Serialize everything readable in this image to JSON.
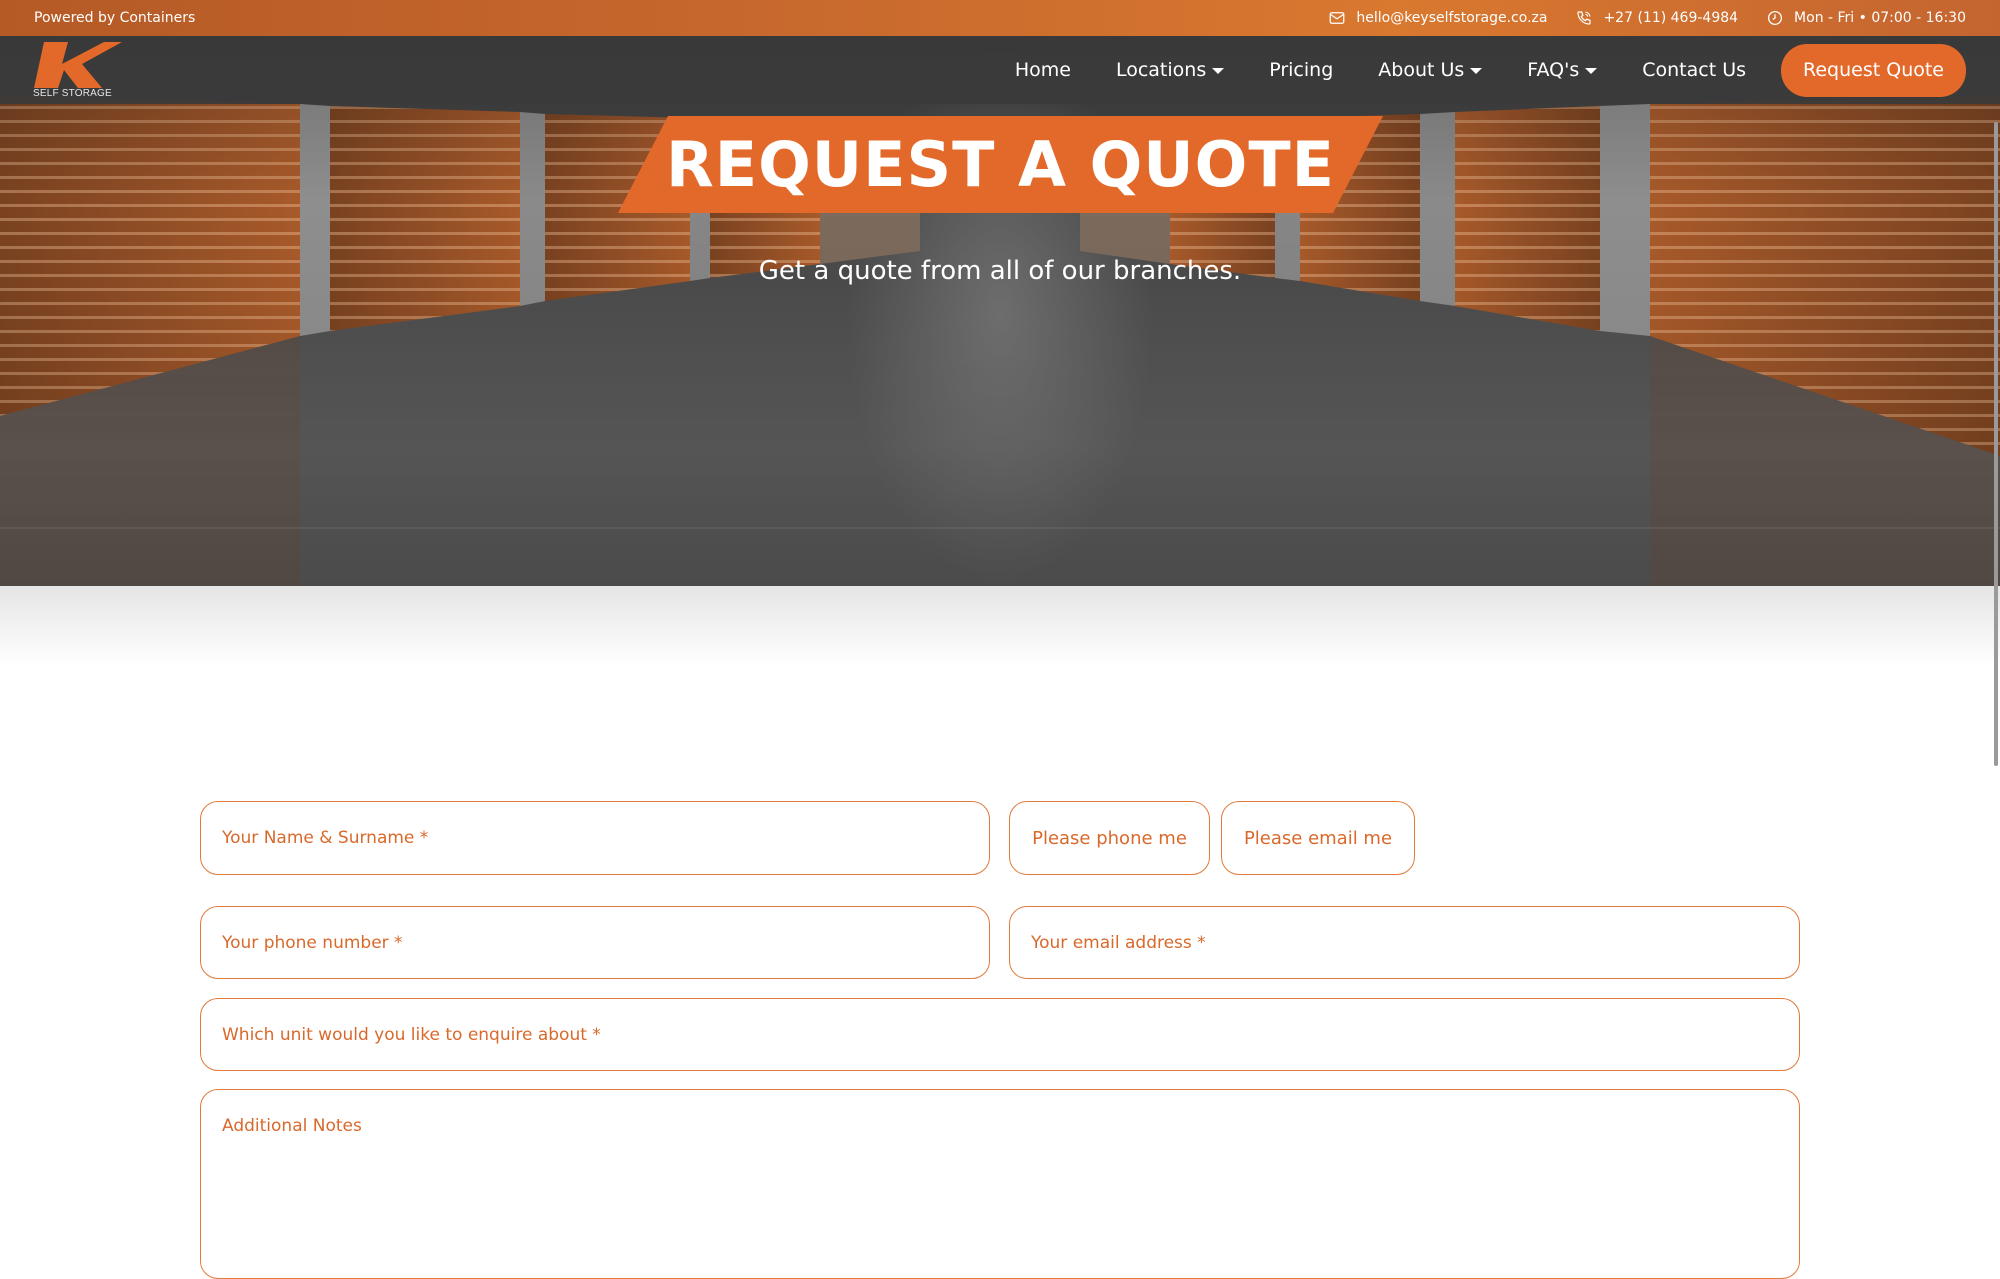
{
  "topbar": {
    "powered": "Powered by Containers",
    "email": "hello@keyselfstorage.co.za",
    "phone": "+27 (11) 469-4984",
    "hours": "Mon - Fri • 07:00 - 16:30"
  },
  "logo": {
    "letter": "K",
    "text": "SELF STORAGE"
  },
  "nav": {
    "items": [
      {
        "label": "Home",
        "dropdown": false
      },
      {
        "label": "Locations",
        "dropdown": true
      },
      {
        "label": "Pricing",
        "dropdown": false
      },
      {
        "label": "About Us",
        "dropdown": true
      },
      {
        "label": "FAQ's",
        "dropdown": true
      },
      {
        "label": "Contact Us",
        "dropdown": false
      }
    ],
    "cta": "Request Quote"
  },
  "hero": {
    "title": "REQUEST A QUOTE",
    "subtitle": "Get a quote from all of our branches."
  },
  "form": {
    "name_placeholder": "Your Name & Surname *",
    "contact_phone": "Please phone me",
    "contact_email": "Please email me",
    "phone_placeholder": "Your phone number *",
    "email_placeholder": "Your email address *",
    "unit_placeholder": "Which unit would you like to enquire about *",
    "notes_placeholder": "Additional Notes"
  },
  "colors": {
    "accent": "#e3692b",
    "nav_bg": "#3a3a3a",
    "field_border": "#e07a3d",
    "field_text": "#d9692b"
  }
}
